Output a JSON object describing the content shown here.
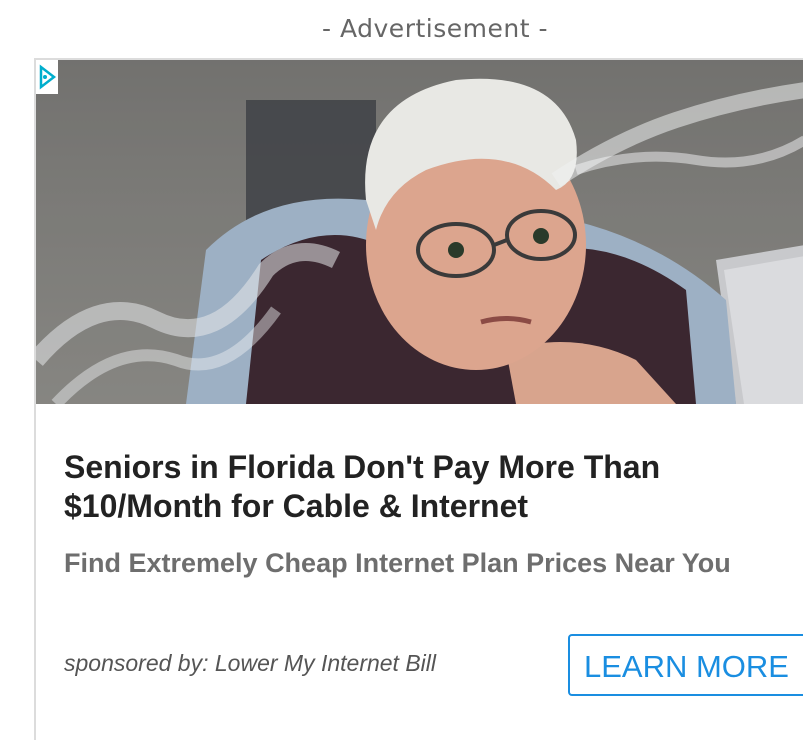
{
  "ad": {
    "label": "- Advertisement -",
    "headline": "Seniors in Florida Don't Pay More Than $10/Month for Cable & Internet",
    "subheadline": "Find Extremely Cheap Internet Plan Prices Near You",
    "sponsor": "sponsored by: Lower My Internet Bill",
    "cta": "LEARN MORE",
    "image_icon": "adchoices-icon",
    "accent_color": "#1a8ee1"
  }
}
